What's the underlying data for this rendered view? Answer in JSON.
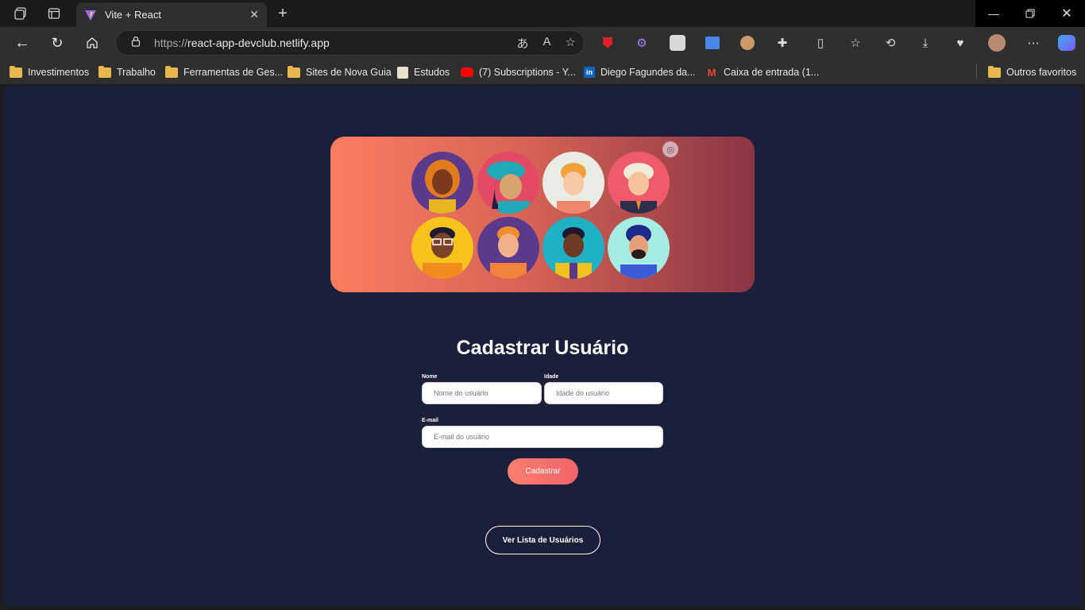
{
  "browser": {
    "tab_title": "Vite + React",
    "url_proto": "https://",
    "url_host": "react-app-devclub.netlify.app",
    "bookmarks": [
      {
        "label": "Investimentos",
        "icon": "folder-icon"
      },
      {
        "label": "Trabalho",
        "icon": "folder-icon"
      },
      {
        "label": "Ferramentas de Ges...",
        "icon": "folder-icon"
      },
      {
        "label": "Sites de Nova Guia",
        "icon": "folder-icon"
      },
      {
        "label": "Estudos",
        "icon": "notepad-icon"
      },
      {
        "label": "(7) Subscriptions - Y...",
        "icon": "youtube-icon"
      },
      {
        "label": "Diego Fagundes da...",
        "icon": "linkedin-icon"
      },
      {
        "label": "Caixa de entrada (1...",
        "icon": "gmail-icon"
      }
    ],
    "other_favorites": "Outros favoritos"
  },
  "page": {
    "title": "Cadastrar Usuário",
    "form": {
      "name_label": "Nome",
      "name_placeholder": "Nome do usuário",
      "age_label": "Idade",
      "age_placeholder": "Idade do usuário",
      "email_label": "E-mail",
      "email_placeholder": "E-mail do usuário",
      "submit_label": "Cadastrar"
    },
    "list_button_label": "Ver Lista de Usuários"
  },
  "colors": {
    "page_bg": "#1b1f3a",
    "hero_gradient_start": "#fa7d60",
    "hero_gradient_end": "#8a3545",
    "submit_start": "#fe7e6e",
    "submit_end": "#f0646a"
  }
}
